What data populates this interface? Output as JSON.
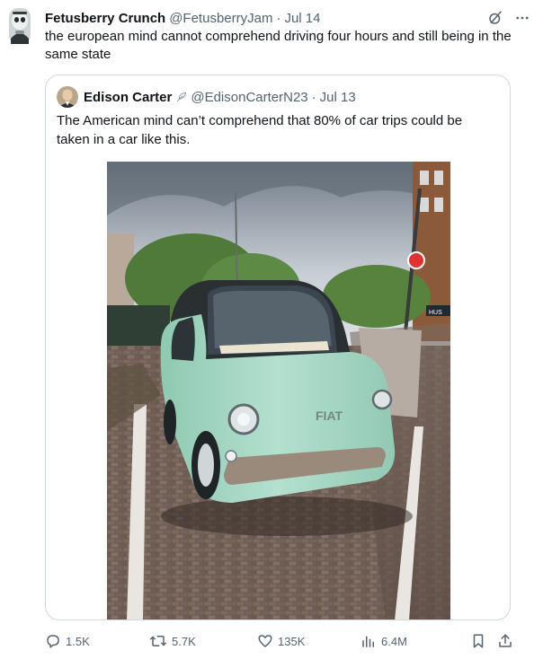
{
  "tweet": {
    "author_name": "Fetusberry Crunch",
    "author_handle": "@FetusberryJam",
    "dot": "·",
    "date": "Jul 14",
    "text": "the european mind cannot comprehend driving four hours and still being in the same state",
    "more_label": "···"
  },
  "quote": {
    "author_name": "Edison Carter",
    "author_handle": "@EdisonCarterN23",
    "dot": "·",
    "date": "Jul 13",
    "text": "The American mind can’t comprehend that 80% of car trips could be taken in a car like this.",
    "car_badge": "FIAT",
    "sign_text": "HUS"
  },
  "actions": {
    "replies": "1.5K",
    "reposts": "5.7K",
    "likes": "135K",
    "views": "6.4M"
  },
  "colors": {
    "text": "#0f1419",
    "secondary": "#536471",
    "border": "#cfd9de",
    "car_body": "#a8d8c4"
  },
  "icons": {
    "header": [
      "grok-icon",
      "more-icon"
    ],
    "actions": [
      "reply-icon",
      "repost-icon",
      "like-icon",
      "views-icon",
      "bookmark-icon",
      "share-icon"
    ]
  }
}
